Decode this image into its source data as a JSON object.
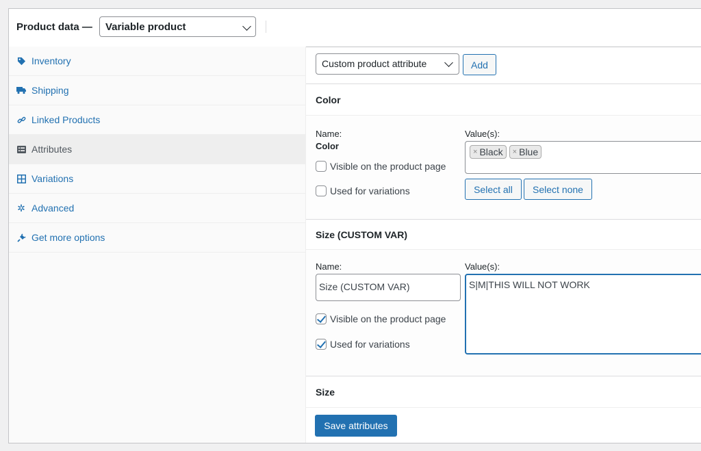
{
  "header": {
    "title": "Product data —",
    "product_type": "Variable product"
  },
  "sidebar": {
    "items": [
      {
        "label": "Inventory",
        "icon": "tag-icon",
        "active": false
      },
      {
        "label": "Shipping",
        "icon": "truck-icon",
        "active": false
      },
      {
        "label": "Linked Products",
        "icon": "link-icon",
        "active": false
      },
      {
        "label": "Attributes",
        "icon": "list-icon",
        "active": true
      },
      {
        "label": "Variations",
        "icon": "grid-icon",
        "active": false
      },
      {
        "label": "Advanced",
        "icon": "gear-icon",
        "active": false
      },
      {
        "label": "Get more options",
        "icon": "plug-icon",
        "active": false
      }
    ]
  },
  "toolbar": {
    "attribute_select": "Custom product attribute",
    "add_label": "Add"
  },
  "attributes": [
    {
      "heading": "Color",
      "name_label": "Name:",
      "name_value": "Color",
      "values_label": "Value(s):",
      "values": [
        "Black",
        "Blue"
      ],
      "visible_label": "Visible on the product page",
      "visible_checked": false,
      "variations_label": "Used for variations",
      "variations_checked": false,
      "select_all_label": "Select all",
      "select_none_label": "Select none"
    },
    {
      "heading": "Size (CUSTOM VAR)",
      "name_label": "Name:",
      "name_value": "Size (CUSTOM VAR)",
      "values_label": "Value(s):",
      "values_text": "S|M|THIS WILL NOT WORK",
      "visible_label": "Visible on the product page",
      "visible_checked": true,
      "variations_label": "Used for variations",
      "variations_checked": true
    },
    {
      "heading": "Size"
    }
  ],
  "save_label": "Save attributes",
  "colors": {
    "accent": "#2271b1",
    "text": "#1d2327",
    "border": "#c3c4c7"
  }
}
